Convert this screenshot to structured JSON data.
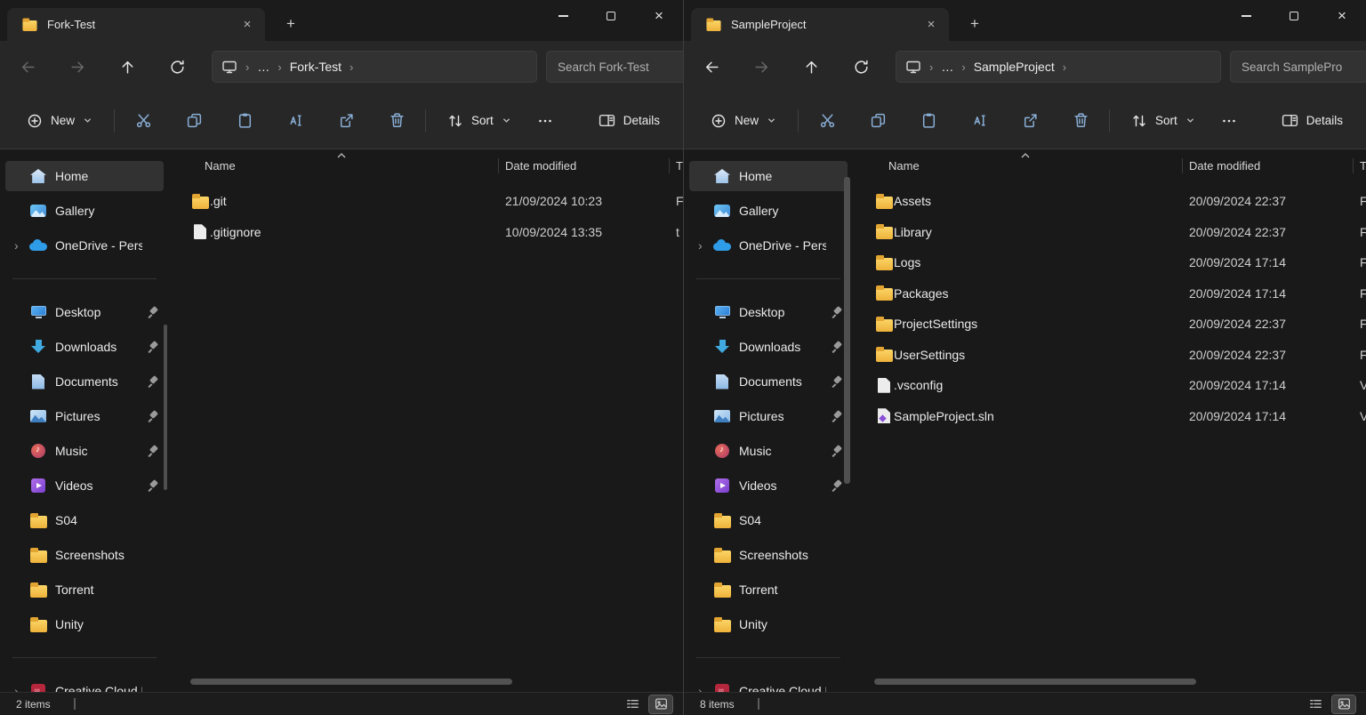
{
  "colors": {
    "folder_yellow": "#f2bf43",
    "command_icon_blue": "#8ab0d8",
    "onedrive_blue": "#2f9ce8",
    "surface": "#272727",
    "content_bg": "#191919"
  },
  "sidebar": {
    "top": [
      {
        "icon": "home",
        "label": "Home",
        "selected": true
      },
      {
        "icon": "gallery",
        "label": "Gallery"
      },
      {
        "icon": "onedrive",
        "label": "OneDrive - Perso",
        "chevron": true
      }
    ],
    "pinned_section": [
      {
        "icon": "desktop",
        "label": "Desktop",
        "pinned": true
      },
      {
        "icon": "downloads",
        "label": "Downloads",
        "pinned": true
      },
      {
        "icon": "documents",
        "label": "Documents",
        "pinned": true
      },
      {
        "icon": "pictures",
        "label": "Pictures",
        "pinned": true
      },
      {
        "icon": "music",
        "label": "Music",
        "pinned": true
      },
      {
        "icon": "videos",
        "label": "Videos",
        "pinned": true
      },
      {
        "icon": "folder",
        "label": "S04"
      },
      {
        "icon": "folder",
        "label": "Screenshots"
      },
      {
        "icon": "folder",
        "label": "Torrent"
      },
      {
        "icon": "folder",
        "label": "Unity"
      }
    ],
    "bottom": [
      {
        "icon": "cc",
        "label": "Creative Cloud F",
        "chevron": true
      }
    ]
  },
  "windows": [
    {
      "tab_title": "Fork-Test",
      "nav": {
        "breadcrumb_collapsed": "…",
        "breadcrumb_current": "Fork-Test",
        "search_placeholder": "Search Fork-Test"
      },
      "commandbar": {
        "new_label": "New",
        "sort_label": "Sort",
        "details_label": "Details"
      },
      "columns": {
        "name": "Name",
        "date": "Date modified",
        "type_partial": "T"
      },
      "files": [
        {
          "icon": "folder",
          "name": ".git",
          "date": "21/09/2024 10:23",
          "type": "F"
        },
        {
          "icon": "file",
          "name": ".gitignore",
          "date": "10/09/2024 13:35",
          "type": "t"
        }
      ],
      "status": {
        "count": "2 items"
      }
    },
    {
      "tab_title": "SampleProject",
      "nav": {
        "breadcrumb_collapsed": "…",
        "breadcrumb_current": "SampleProject",
        "search_placeholder": "Search SamplePro"
      },
      "commandbar": {
        "new_label": "New",
        "sort_label": "Sort",
        "details_label": "Details"
      },
      "columns": {
        "name": "Name",
        "date": "Date modified",
        "type_partial": "T"
      },
      "files": [
        {
          "icon": "folder",
          "name": "Assets",
          "date": "20/09/2024 22:37",
          "type": "F"
        },
        {
          "icon": "folder",
          "name": "Library",
          "date": "20/09/2024 22:37",
          "type": "F"
        },
        {
          "icon": "folder",
          "name": "Logs",
          "date": "20/09/2024 17:14",
          "type": "F"
        },
        {
          "icon": "folder",
          "name": "Packages",
          "date": "20/09/2024 17:14",
          "type": "F"
        },
        {
          "icon": "folder",
          "name": "ProjectSettings",
          "date": "20/09/2024 22:37",
          "type": "F"
        },
        {
          "icon": "folder",
          "name": "UserSettings",
          "date": "20/09/2024 22:37",
          "type": "F"
        },
        {
          "icon": "file",
          "name": ".vsconfig",
          "date": "20/09/2024 17:14",
          "type": "V"
        },
        {
          "icon": "sln",
          "name": "SampleProject.sln",
          "date": "20/09/2024 17:14",
          "type": "V"
        }
      ],
      "status": {
        "count": "8 items"
      }
    }
  ]
}
